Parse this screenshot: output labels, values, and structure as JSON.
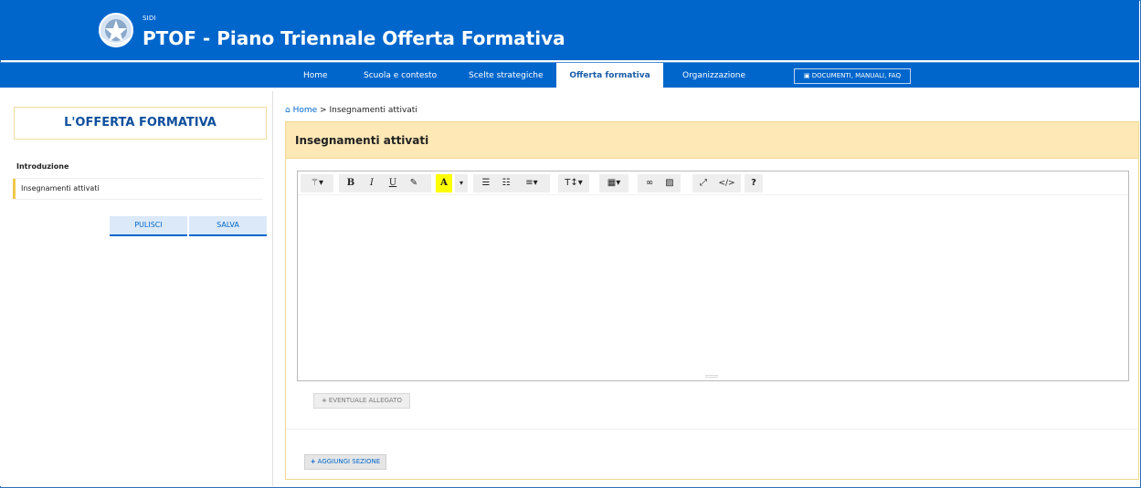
{
  "header": {
    "sidi_label": "SIDI",
    "app_title": "PTOF - Piano Triennale Offerta Formativa"
  },
  "nav": {
    "items": [
      {
        "label": "Home"
      },
      {
        "label": "Scuola e contesto"
      },
      {
        "label": "Scelte strategiche"
      },
      {
        "label": "Offerta formativa",
        "active": true
      },
      {
        "label": "Organizzazione"
      }
    ],
    "docs_label": "DOCUMENTI, MANUALI, FAQ"
  },
  "sidebar": {
    "title": "L'OFFERTA FORMATIVA",
    "intro_label": "Introduzione",
    "active_item": "Insegnamenti attivati",
    "clear_label": "PULISCI",
    "save_label": "SALVA"
  },
  "breadcrumb": {
    "home": "Home",
    "separator": ">",
    "current": "Insegnamenti attivati"
  },
  "main": {
    "section_title": "Insegnamenti attivati",
    "toolbar": {
      "style_glyph": "⚚",
      "bold_glyph": "B",
      "italic_glyph": "I",
      "underline_glyph": "U",
      "eraser_glyph": "✎",
      "font_color_glyph": "A",
      "ul_glyph": "☰",
      "ol_glyph": "☷",
      "align_glyph": "≡",
      "text_height_glyph": "T↕",
      "table_glyph": "▦",
      "link_glyph": "∞",
      "image_glyph": "▨",
      "fullscreen_glyph": "⤢",
      "code_glyph": "</>",
      "help_glyph": "?"
    },
    "attachment_label": "EVENTUALE ALLEGATO",
    "add_section_label": "AGGIUNGI SEZIONE"
  },
  "colors": {
    "brand_blue": "#0066cc",
    "section_header": "#fde8b6",
    "section_border": "#f1d88e",
    "highlight_yellow": "#ffff00"
  },
  "icons": [
    "emblem-icon",
    "home-icon",
    "book-icon",
    "plus-icon"
  ]
}
